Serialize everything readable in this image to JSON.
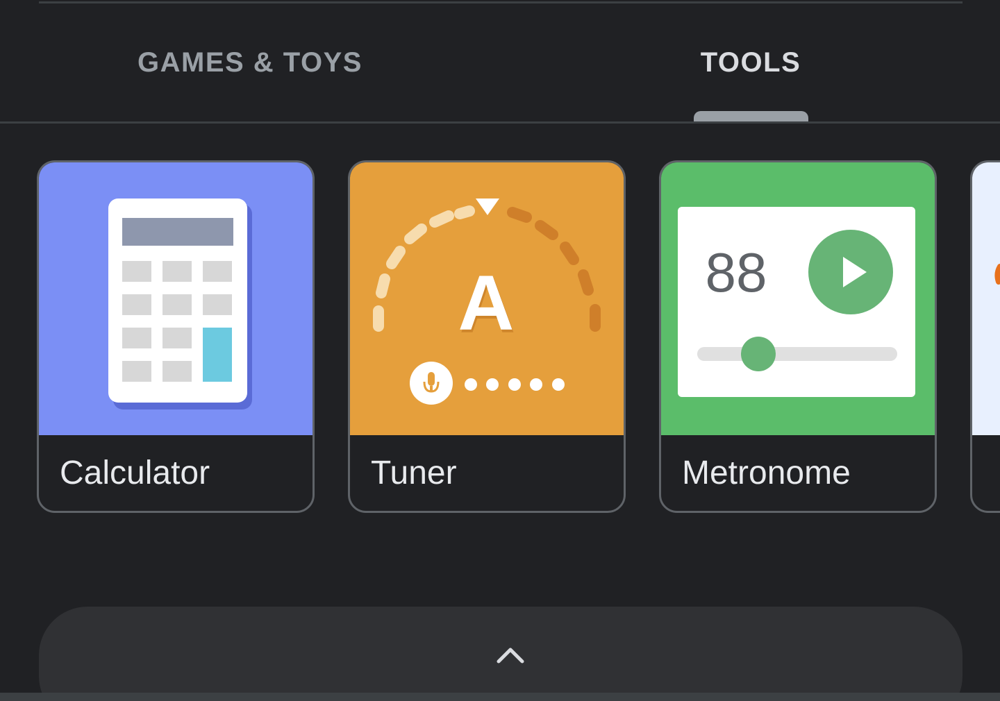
{
  "tabs": [
    {
      "label": "GAMES & TOYS",
      "selected": false
    },
    {
      "label": "TOOLS",
      "selected": true
    }
  ],
  "cards": [
    {
      "label": "Calculator",
      "icon": "calculator-icon",
      "color": "#7b8ff5"
    },
    {
      "label": "Tuner",
      "icon": "tuner-icon",
      "color": "#e59f3c",
      "note": "A"
    },
    {
      "label": "Metronome",
      "icon": "metronome-icon",
      "color": "#5bbd6a",
      "bpm": "88"
    },
    {
      "label": "",
      "icon": "unknown-tool-icon",
      "color": "#e8f0fe"
    }
  ],
  "bottom_bar": {
    "icon": "chevron-up-icon"
  },
  "colors": {
    "background": "#202124",
    "tab_indicator": "#9aa0a6",
    "card_border": "#5f6368"
  }
}
